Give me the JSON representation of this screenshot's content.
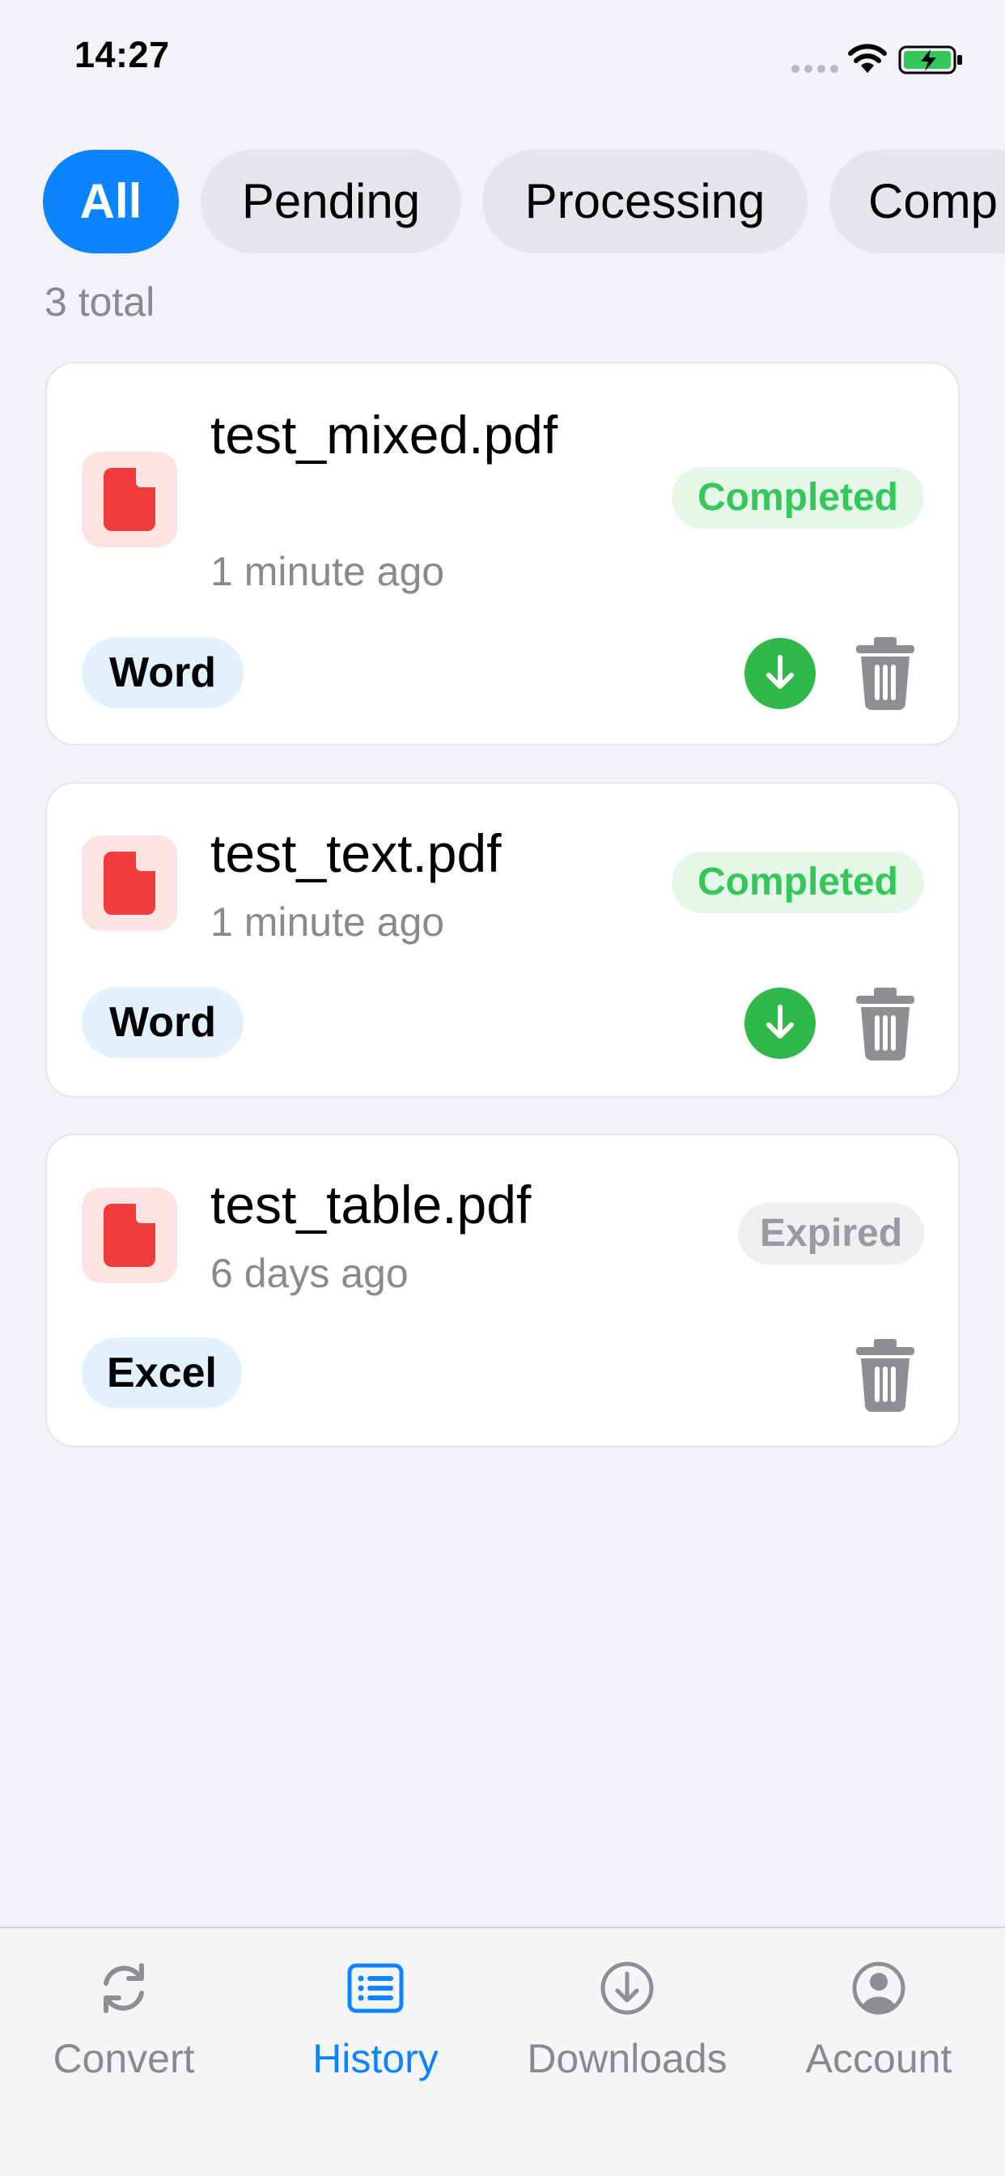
{
  "status_bar": {
    "time": "14:27"
  },
  "filters": {
    "chips": [
      {
        "label": "All",
        "active": true
      },
      {
        "label": "Pending",
        "active": false
      },
      {
        "label": "Processing",
        "active": false
      },
      {
        "label": "Comp",
        "active": false
      }
    ]
  },
  "summary": {
    "total": "3 total"
  },
  "conversions": [
    {
      "file_name": "test_mixed.pdf",
      "time": "1 minute ago",
      "status": "Completed",
      "format": "Word",
      "can_download": true
    },
    {
      "file_name": "test_text.pdf",
      "time": "1 minute ago",
      "status": "Completed",
      "format": "Word",
      "can_download": true
    },
    {
      "file_name": "test_table.pdf",
      "time": "6 days ago",
      "status": "Expired",
      "format": "Excel",
      "can_download": false
    }
  ],
  "tab_bar": {
    "tabs": [
      {
        "label": "Convert",
        "icon": "refresh-icon",
        "active": false
      },
      {
        "label": "History",
        "icon": "list-icon",
        "active": true
      },
      {
        "label": "Downloads",
        "icon": "download-circle-icon",
        "active": false
      },
      {
        "label": "Account",
        "icon": "person-circle-icon",
        "active": false
      }
    ]
  },
  "colors": {
    "accent": "#0a84ff",
    "success": "#34c759",
    "pdf_red": "#f23b3b",
    "background": "#f2f2f7"
  }
}
